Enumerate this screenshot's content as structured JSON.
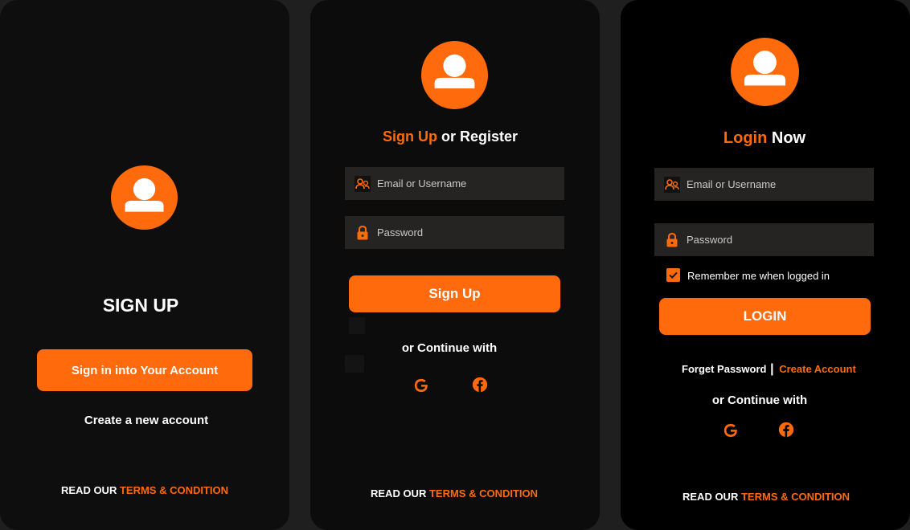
{
  "colors": {
    "accent": "#ff6a0c",
    "panel_bg": "#0e0e0e",
    "field_bg": "#252423",
    "text": "#ffffff"
  },
  "screen1": {
    "title": "SIGN UP",
    "primary_button": "Sign in into Your Account",
    "secondary_link": "Create a new account",
    "footer_prefix": "READ OUR",
    "footer_link": "TERMS & CONDITION",
    "avatar_icon": "user-icon"
  },
  "screen2": {
    "heading_accent": "Sign Up",
    "heading_rest": "or Register",
    "email_placeholder": "Email or Username",
    "password_placeholder": "Password",
    "submit_button": "Sign Up",
    "continue_text": "or Continue with",
    "social": [
      "google-icon",
      "facebook-icon"
    ],
    "footer_prefix": "READ OUR",
    "footer_link": "TERMS & CONDITION"
  },
  "screen3": {
    "heading_accent": "Login",
    "heading_rest": "Now",
    "email_placeholder": "Email or Username",
    "password_placeholder": "Password",
    "remember_label": "Remember me when logged in",
    "remember_checked": true,
    "submit_button": "LOGIN",
    "forget_password": "Forget Password",
    "separator": "|",
    "create_account": "Create Account",
    "continue_text": "or Continue with",
    "social": [
      "google-icon",
      "facebook-icon"
    ],
    "footer_prefix": "READ OUR",
    "footer_link": "TERMS & CONDITION"
  }
}
